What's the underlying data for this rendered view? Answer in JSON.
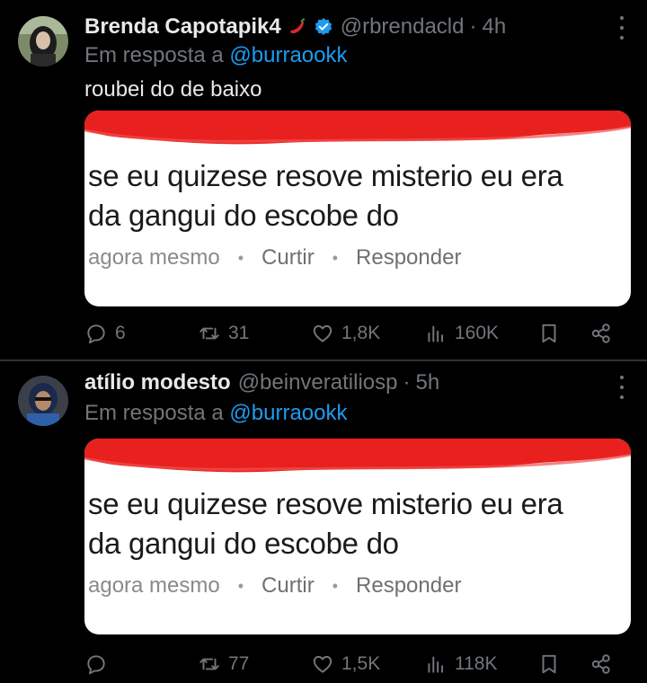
{
  "tweets": [
    {
      "author_name": "Brenda Capotapik4",
      "author_emoji": "chili-pepper",
      "verified": true,
      "handle": "@rbrendacld",
      "dot": "·",
      "time": "4h",
      "reply_prefix": "Em resposta a",
      "reply_to": "@burraookk",
      "text": "roubei do de baixo",
      "media": {
        "line1": "se eu quizese resove misterio eu era",
        "line2": "da gangui do escobe do",
        "meta_time": "agora mesmo",
        "meta_sep": "•",
        "meta_like": "Curtir",
        "meta_reply": "Responder"
      },
      "actions": {
        "replies": "6",
        "retweets": "31",
        "likes": "1,8K",
        "views": "160K"
      }
    },
    {
      "author_name": "atílio modesto",
      "handle": "@beinveratiliosp",
      "dot": "·",
      "time": "5h",
      "reply_prefix": "Em resposta a",
      "reply_to": "@burraookk",
      "media": {
        "line1": "se eu quizese resove misterio eu era",
        "line2": "da gangui do escobe do",
        "meta_time": "agora mesmo",
        "meta_sep": "•",
        "meta_like": "Curtir",
        "meta_reply": "Responder"
      },
      "actions": {
        "replies": "",
        "retweets": "77",
        "likes": "1,5K",
        "views": "118K"
      }
    }
  ],
  "colors": {
    "background": "#000000",
    "text": "#e7e9ea",
    "muted": "#71767b",
    "link": "#1d9bf0",
    "verified": "#1d9bf0"
  },
  "icons": [
    "reply-icon",
    "retweet-icon",
    "like-icon",
    "views-icon",
    "bookmark-icon",
    "share-icon",
    "more-icon",
    "verified-icon",
    "chili-pepper-icon"
  ]
}
